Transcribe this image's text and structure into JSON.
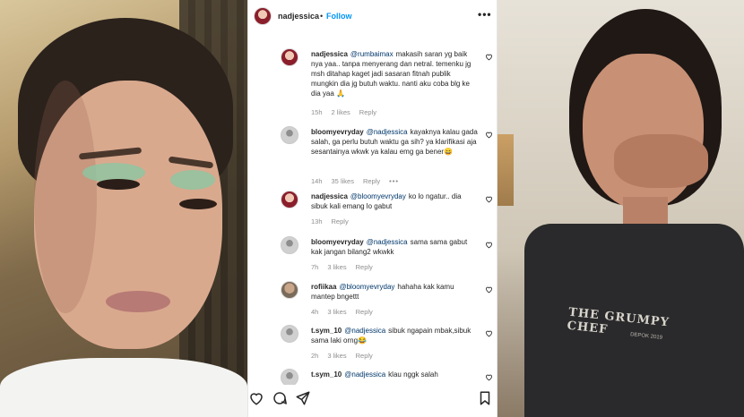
{
  "post": {
    "username": "nadjessica",
    "separator": "•",
    "follow_label": "Follow",
    "more_label": "•••"
  },
  "apron": {
    "brand": "THE GRUMPY CHEF",
    "sub": "DEPOK 2019"
  },
  "comments": [
    {
      "avatar": "profile",
      "username": "nadjessica",
      "mention": "@rumbaimax",
      "text": "makasih saran yg baik nya yaa.. tanpa menyerang dan netral. temenku jg msh ditahap kaget jadi sasaran fitnah publik mungkin dia jg butuh waktu. nanti aku coba blg ke dia yaa 🙏",
      "time": "15h",
      "likes": "2 likes",
      "reply": "Reply",
      "more": ""
    },
    {
      "avatar": "default",
      "username": "bloomyevryday",
      "mention": "@nadjessica",
      "text": "kayaknya kalau gada salah, ga perlu butuh waktu ga sih? ya klarifikasi aja sesantainya wkwk ya kalau emg ga bener😄",
      "time": "14h",
      "likes": "35 likes",
      "reply": "Reply",
      "more": "•••"
    },
    {
      "avatar": "profile",
      "username": "nadjessica",
      "mention": "@bloomyevryday",
      "text": "ko lo ngatur.. dia sibuk kali emang lo gabut",
      "time": "13h",
      "likes": "",
      "reply": "Reply",
      "more": ""
    },
    {
      "avatar": "default",
      "username": "bloomyevryday",
      "mention": "@nadjessica",
      "text": "sama sama gabut kak jangan bilang2 wkwkk",
      "time": "7h",
      "likes": "3 likes",
      "reply": "Reply",
      "more": ""
    },
    {
      "avatar": "photo",
      "username": "rofiikaa",
      "mention": "@bloomyevryday",
      "text": "hahaha kak kamu mantep bngettt",
      "time": "4h",
      "likes": "3 likes",
      "reply": "Reply",
      "more": ""
    },
    {
      "avatar": "default",
      "username": "t.sym_10",
      "mention": "@nadjessica",
      "text": "sibuk ngapain mbak,sibuk sama laki orng😂",
      "time": "2h",
      "likes": "3 likes",
      "reply": "Reply",
      "more": ""
    },
    {
      "avatar": "default",
      "username": "t.sym_10",
      "mention": "@nadjessica",
      "text": "klau nggk salah",
      "time": "",
      "likes": "",
      "reply": "",
      "more": ""
    }
  ],
  "actions": {
    "like_icon": "heart-icon",
    "comment_icon": "comment-icon",
    "share_icon": "share-icon",
    "save_icon": "bookmark-icon"
  },
  "colors": {
    "link": "#00376b",
    "follow": "#0095f6",
    "muted": "#8e8e8e",
    "text": "#262626"
  }
}
